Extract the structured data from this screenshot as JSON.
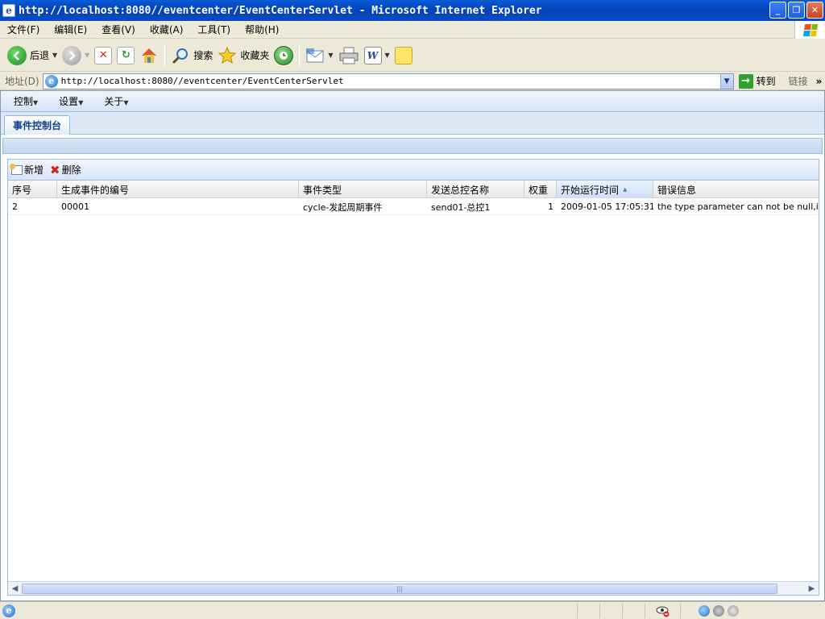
{
  "window": {
    "title": "http://localhost:8080//eventcenter/EventCenterServlet - Microsoft Internet Explorer",
    "app_icon_glyph": "e",
    "minimize_glyph": "_",
    "restore_glyph": "❐",
    "close_glyph": "✕"
  },
  "menubar": {
    "items": [
      "文件(F)",
      "编辑(E)",
      "查看(V)",
      "收藏(A)",
      "工具(T)",
      "帮助(H)"
    ]
  },
  "toolbar": {
    "back_label": "后退",
    "search_label": "搜索",
    "favorites_label": "收藏夹"
  },
  "address": {
    "label": "地址(D)",
    "url": "http://localhost:8080//eventcenter/EventCenterServlet",
    "go_label": "转到",
    "links_label": "链接",
    "more_glyph": "»"
  },
  "app_menu": {
    "items": [
      "控制",
      "设置",
      "关于"
    ]
  },
  "tabs": [
    {
      "label": "事件控制台"
    }
  ],
  "grid": {
    "toolbar": {
      "add_label": "新增",
      "delete_label": "删除"
    },
    "columns": [
      "序号",
      "生成事件的编号",
      "事件类型",
      "发送总控名称",
      "权重",
      "开始运行时间",
      "错误信息"
    ],
    "sorted_column": "开始运行时间",
    "rows": [
      [
        "2",
        "00001",
        "cycle-发起周期事件",
        "send01-总控1",
        "1",
        "2009-01-05 17:05:31",
        "the type parameter can not be null,interpo"
      ]
    ]
  },
  "colors": {
    "title_bar": "#0343b8",
    "panel_border": "#99bbe8",
    "tab_text": "#15428b"
  }
}
